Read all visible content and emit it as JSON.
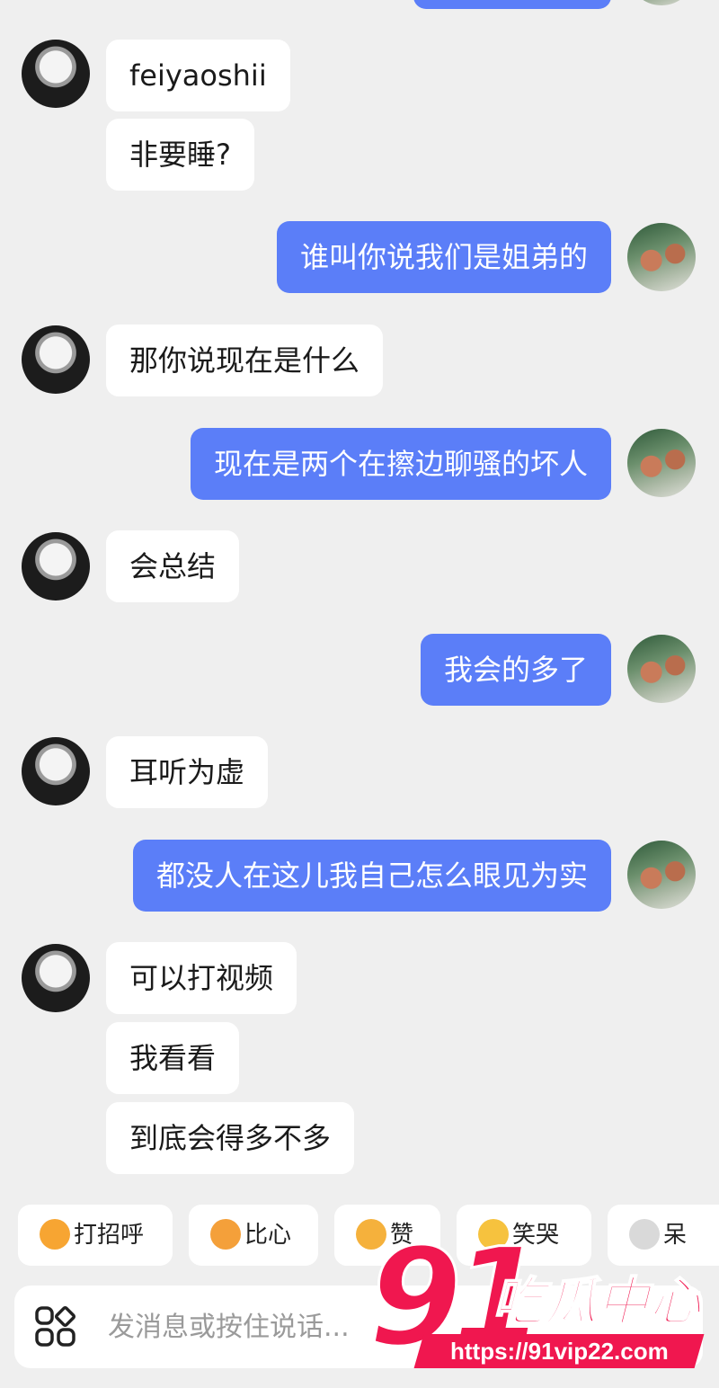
{
  "messages": [
    {
      "side": "in",
      "username": "feiyaoshii",
      "text": "非要睡?"
    },
    {
      "side": "out",
      "text": "谁叫你说我们是姐弟的"
    },
    {
      "side": "in",
      "text": "那你说现在是什么"
    },
    {
      "side": "out",
      "text": "现在是两个在擦边聊骚的坏人"
    },
    {
      "side": "in",
      "text": "会总结"
    },
    {
      "side": "out",
      "text": "我会的多了"
    },
    {
      "side": "in",
      "text": "耳听为虚"
    },
    {
      "side": "out",
      "text": "都没人在这儿我自己怎么眼见为实"
    },
    {
      "side": "in",
      "text": "可以打视频"
    },
    {
      "side": "in",
      "text": "我看看"
    },
    {
      "side": "in",
      "text": "到底会得多不多"
    }
  ],
  "quick_replies": [
    {
      "label": "打招呼",
      "icon": "smile-emoji-icon",
      "color": "#f7a532"
    },
    {
      "label": "比心",
      "icon": "heart-hands-emoji-icon",
      "color": "#f4a03a"
    },
    {
      "label": "赞",
      "icon": "thumbs-up-emoji-icon",
      "color": "#f5b13c"
    },
    {
      "label": "笑哭",
      "icon": "laugh-cry-emoji-icon",
      "color": "#f6c23e"
    },
    {
      "label": "呆",
      "icon": "cat-emoji-icon",
      "color": "#d9d9d9"
    }
  ],
  "input": {
    "placeholder": "发消息或按住说话..."
  },
  "watermark": {
    "number": "91",
    "name": "吃瓜中心",
    "url": "https://91vip22.com"
  },
  "colors": {
    "background": "#efefef",
    "outgoing_bubble": "#5b7ef8",
    "incoming_bubble": "#ffffff",
    "watermark": "#f0174f"
  }
}
